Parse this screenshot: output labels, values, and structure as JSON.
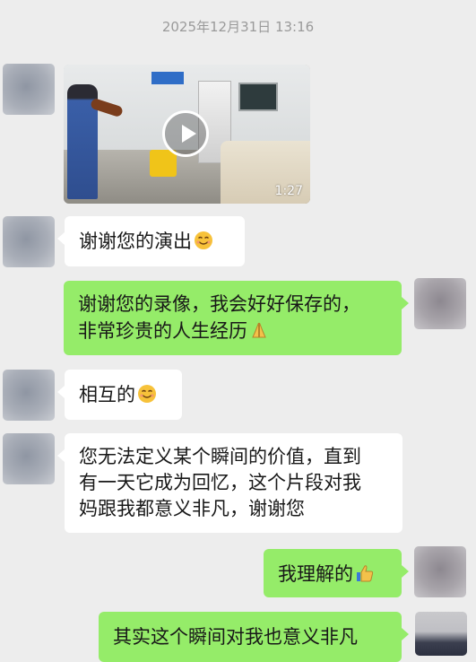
{
  "header": {
    "timestamp": "2025年12月31日 13:16"
  },
  "messages": [
    {
      "side": "in",
      "type": "video",
      "duration": "1:27"
    },
    {
      "side": "in",
      "text": "谢谢您的演出",
      "emoji": "smiling-face"
    },
    {
      "side": "out",
      "lines": [
        "谢谢您的录像，我会好好保存的，",
        "非常珍贵的人生经历"
      ],
      "emoji": "folded-hands"
    },
    {
      "side": "in",
      "text": "相互的",
      "emoji": "smiling-face"
    },
    {
      "side": "in",
      "lines": [
        "您无法定义某个瞬间的价值，直到",
        "有一天它成为回忆，这个片段对我",
        "妈跟我都意义非凡，谢谢您"
      ]
    },
    {
      "side": "out",
      "text": "我理解的",
      "emoji": "thumbs-up"
    },
    {
      "side": "out",
      "text": "其实这个瞬间对我也意义非凡"
    }
  ],
  "colors": {
    "background": "#ededed",
    "incoming": "#ffffff",
    "outgoing": "#95ec69",
    "timestamp": "#9a9a9a"
  }
}
